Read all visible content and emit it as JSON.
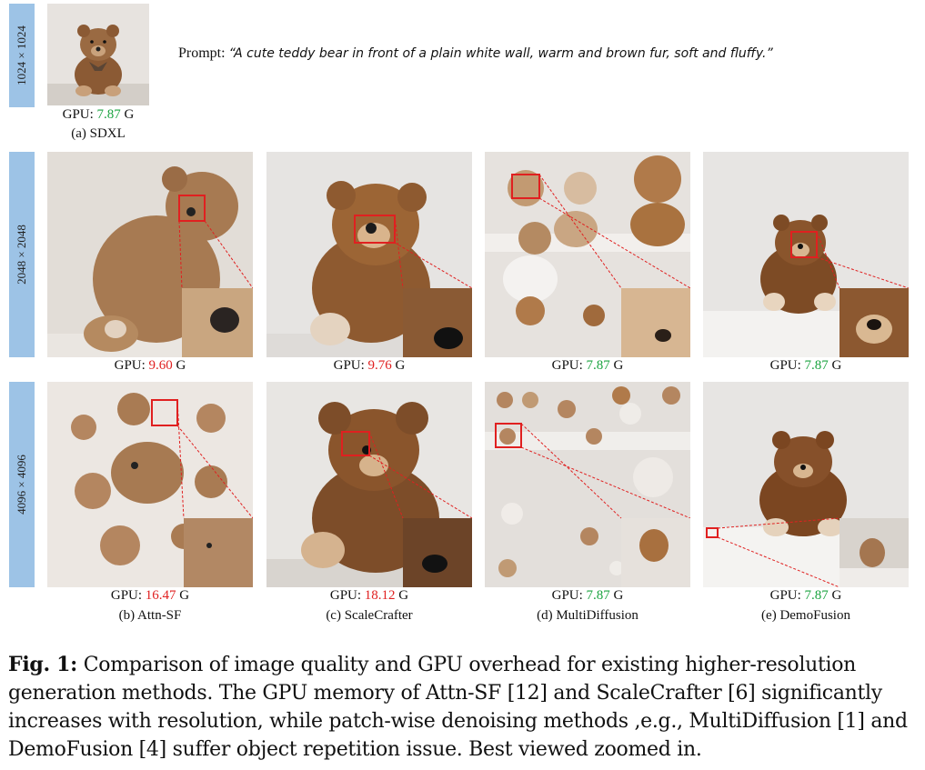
{
  "figure": {
    "resolutions": [
      "1024 × 1024",
      "2048 × 2048",
      "4096 × 4096"
    ],
    "prompt_label": "Prompt:",
    "prompt_text": "“A cute teddy bear in front of a plain white wall, warm and brown fur, soft and fluffy.”",
    "gpu_label": "GPU:",
    "gpu_unit": "G",
    "colors": {
      "green": "#1aa33f",
      "red": "#e02020",
      "tag": "#9dc3e6"
    },
    "sdxl": {
      "gpu": "7.87",
      "gpu_color": "green",
      "label": "(a) SDXL"
    },
    "row_2048": [
      {
        "gpu": "9.60",
        "gpu_color": "red"
      },
      {
        "gpu": "9.76",
        "gpu_color": "red"
      },
      {
        "gpu": "7.87",
        "gpu_color": "green"
      },
      {
        "gpu": "7.87",
        "gpu_color": "green"
      }
    ],
    "row_4096": [
      {
        "gpu": "16.47",
        "gpu_color": "red",
        "label": "(b) Attn-SF"
      },
      {
        "gpu": "18.12",
        "gpu_color": "red",
        "label": "(c) ScaleCrafter"
      },
      {
        "gpu": "7.87",
        "gpu_color": "green",
        "label": "(d) MultiDiffusion"
      },
      {
        "gpu": "7.87",
        "gpu_color": "green",
        "label": "(e) DemoFusion"
      }
    ]
  },
  "caption": {
    "fig_label": "Fig. 1:",
    "text": "Comparison of image quality and GPU overhead for existing higher-resolution generation methods. The GPU memory of Attn-SF [12] and ScaleCrafter [6] significantly increases with resolution, while patch-wise denoising methods ,e.g., MultiDiffusion [1] and DemoFusion [4] suffer object repetition issue. Best viewed zoomed in."
  }
}
